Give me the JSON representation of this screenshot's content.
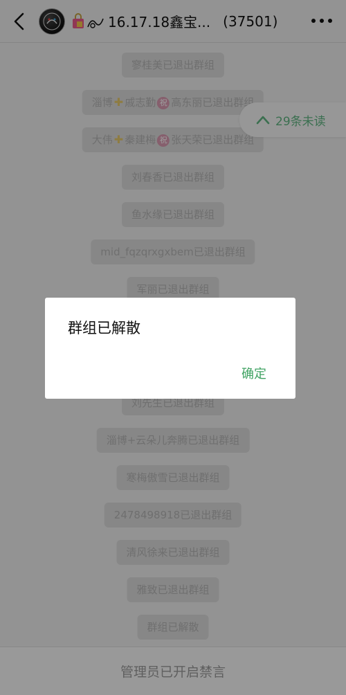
{
  "header": {
    "back_icon": "chevron-left-icon",
    "avatar_icon": "group-avatar",
    "title": "16.17.18鑫宝...",
    "member_count": "(37501)",
    "more_icon": "more-dots-icon"
  },
  "unread": {
    "label": "29条未读",
    "icon": "chevron-up-icon"
  },
  "messages": [
    "寥桂美已退出群组",
    "淄博",
    "戚志勤",
    "高东丽已退出群组",
    "大伟",
    "秦建梅",
    "张天荣已退出群组",
    "刘春香已退出群组",
    "鱼水缘已退出群组",
    "mid_fqzqrxgxbem已退出群组",
    "军丽已退出群组",
    "刘先生已退出群组",
    "淄博+云朵儿奔腾已退出群组",
    "寒梅傲雪已退出群组",
    "2478498918已退出群组",
    "清风徐来已退出群组",
    "雅致已退出群组",
    "群组已解散"
  ],
  "badge_text": "祝",
  "bottom_bar": {
    "text": "管理员已开启禁言"
  },
  "dialog": {
    "message": "群组已解散",
    "confirm": "确定"
  },
  "colors": {
    "accent_green": "#3fa262",
    "unread_green": "#5fb481"
  }
}
